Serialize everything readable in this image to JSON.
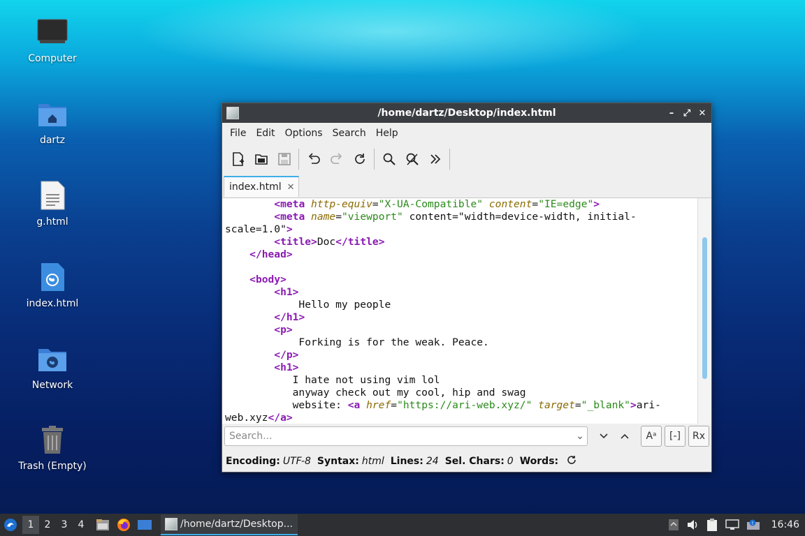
{
  "desktop": {
    "icons": [
      {
        "label": "Computer"
      },
      {
        "label": "dartz"
      },
      {
        "label": "g.html"
      },
      {
        "label": "index.html"
      },
      {
        "label": "Network"
      },
      {
        "label": "Trash (Empty)"
      }
    ]
  },
  "window": {
    "title": "/home/dartz/Desktop/index.html",
    "controls": {
      "minimize": "–",
      "maximize": "⤢",
      "close": "✕"
    },
    "menu": [
      "File",
      "Edit",
      "Options",
      "Search",
      "Help"
    ],
    "toolbar": [
      "new-file-icon",
      "open-folder-icon",
      "save-icon",
      "undo-icon",
      "redo-icon",
      "reload-icon",
      "find-icon",
      "replace-icon",
      "more-icon"
    ],
    "tab": {
      "label": "index.html",
      "close": "✕"
    },
    "code_lines": [
      "        <meta http-equiv=\"X-UA-Compatible\" content=\"IE=edge\">",
      "        <meta name=\"viewport\" content=\"width=device-width, initial-",
      "scale=1.0\">",
      "        <title>Doc</title>",
      "    </head>",
      "",
      "    <body>",
      "        <h1>",
      "            Hello my people",
      "        </h1>",
      "        <p>",
      "            Forking is for the weak. Peace.",
      "        </p>",
      "        <h1>",
      "           I hate not using vim lol",
      "           anyway check out my cool, hip and swag",
      "           website: <a href=\"https://ari-web.xyz/\" target=\"_blank\">ari-",
      "web.xyz</a>"
    ],
    "search": {
      "placeholder": "Search...",
      "case_btn": "Aᵃ",
      "whole_btn": "[-]",
      "regex_btn": "Rx"
    },
    "status": {
      "encoding_label": "Encoding:",
      "encoding": "UTF-8",
      "syntax_label": "Syntax:",
      "syntax": "html",
      "lines_label": "Lines:",
      "lines": "24",
      "sel_label": "Sel. Chars:",
      "sel": "0",
      "words_label": "Words:"
    }
  },
  "panel": {
    "workspaces": [
      "1",
      "2",
      "3",
      "4"
    ],
    "task_label": "/home/dartz/Desktop...",
    "clock": "16:46"
  }
}
